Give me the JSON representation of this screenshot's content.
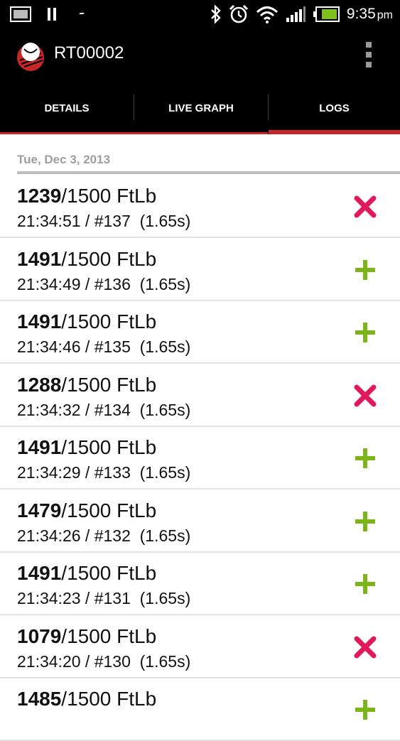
{
  "status_bar": {
    "time": "9:35",
    "ampm": "pm",
    "icons": [
      "screenshot-icon",
      "pause-icon",
      "lightning-icon",
      "bluetooth-icon",
      "alarm-icon",
      "wifi-icon",
      "signal-icon",
      "battery-icon"
    ]
  },
  "app_bar": {
    "title": "RT00002",
    "logo": "app-logo",
    "menu_icon": "overflow-menu-icon"
  },
  "tabs": [
    {
      "label": "DETAILS",
      "selected": false
    },
    {
      "label": "LIVE GRAPH",
      "selected": false
    },
    {
      "label": "LOGS",
      "selected": true
    }
  ],
  "logs": {
    "date_header": "Tue, Dec 3, 2013",
    "entries": [
      {
        "value": "1239",
        "target": "/1500 FtLb",
        "meta": "21:34:51 / #137  (1.65s)",
        "status": "fail"
      },
      {
        "value": "1491",
        "target": "/1500 FtLb",
        "meta": "21:34:49 / #136  (1.65s)",
        "status": "pass"
      },
      {
        "value": "1491",
        "target": "/1500 FtLb",
        "meta": "21:34:46 / #135  (1.65s)",
        "status": "pass"
      },
      {
        "value": "1288",
        "target": "/1500 FtLb",
        "meta": "21:34:32 / #134  (1.65s)",
        "status": "fail"
      },
      {
        "value": "1491",
        "target": "/1500 FtLb",
        "meta": "21:34:29 / #133  (1.65s)",
        "status": "pass"
      },
      {
        "value": "1479",
        "target": "/1500 FtLb",
        "meta": "21:34:26 / #132  (1.65s)",
        "status": "pass"
      },
      {
        "value": "1491",
        "target": "/1500 FtLb",
        "meta": "21:34:23 / #131  (1.65s)",
        "status": "pass"
      },
      {
        "value": "1079",
        "target": "/1500 FtLb",
        "meta": "21:34:20 / #130  (1.65s)",
        "status": "fail"
      },
      {
        "value": "1485",
        "target": "/1500 FtLb",
        "meta": "",
        "status": "pass"
      }
    ]
  },
  "colors": {
    "accent": "#c8272a",
    "pass": "#7cb518",
    "fail": "#e0195a",
    "header_text": "#9e9e9e"
  }
}
